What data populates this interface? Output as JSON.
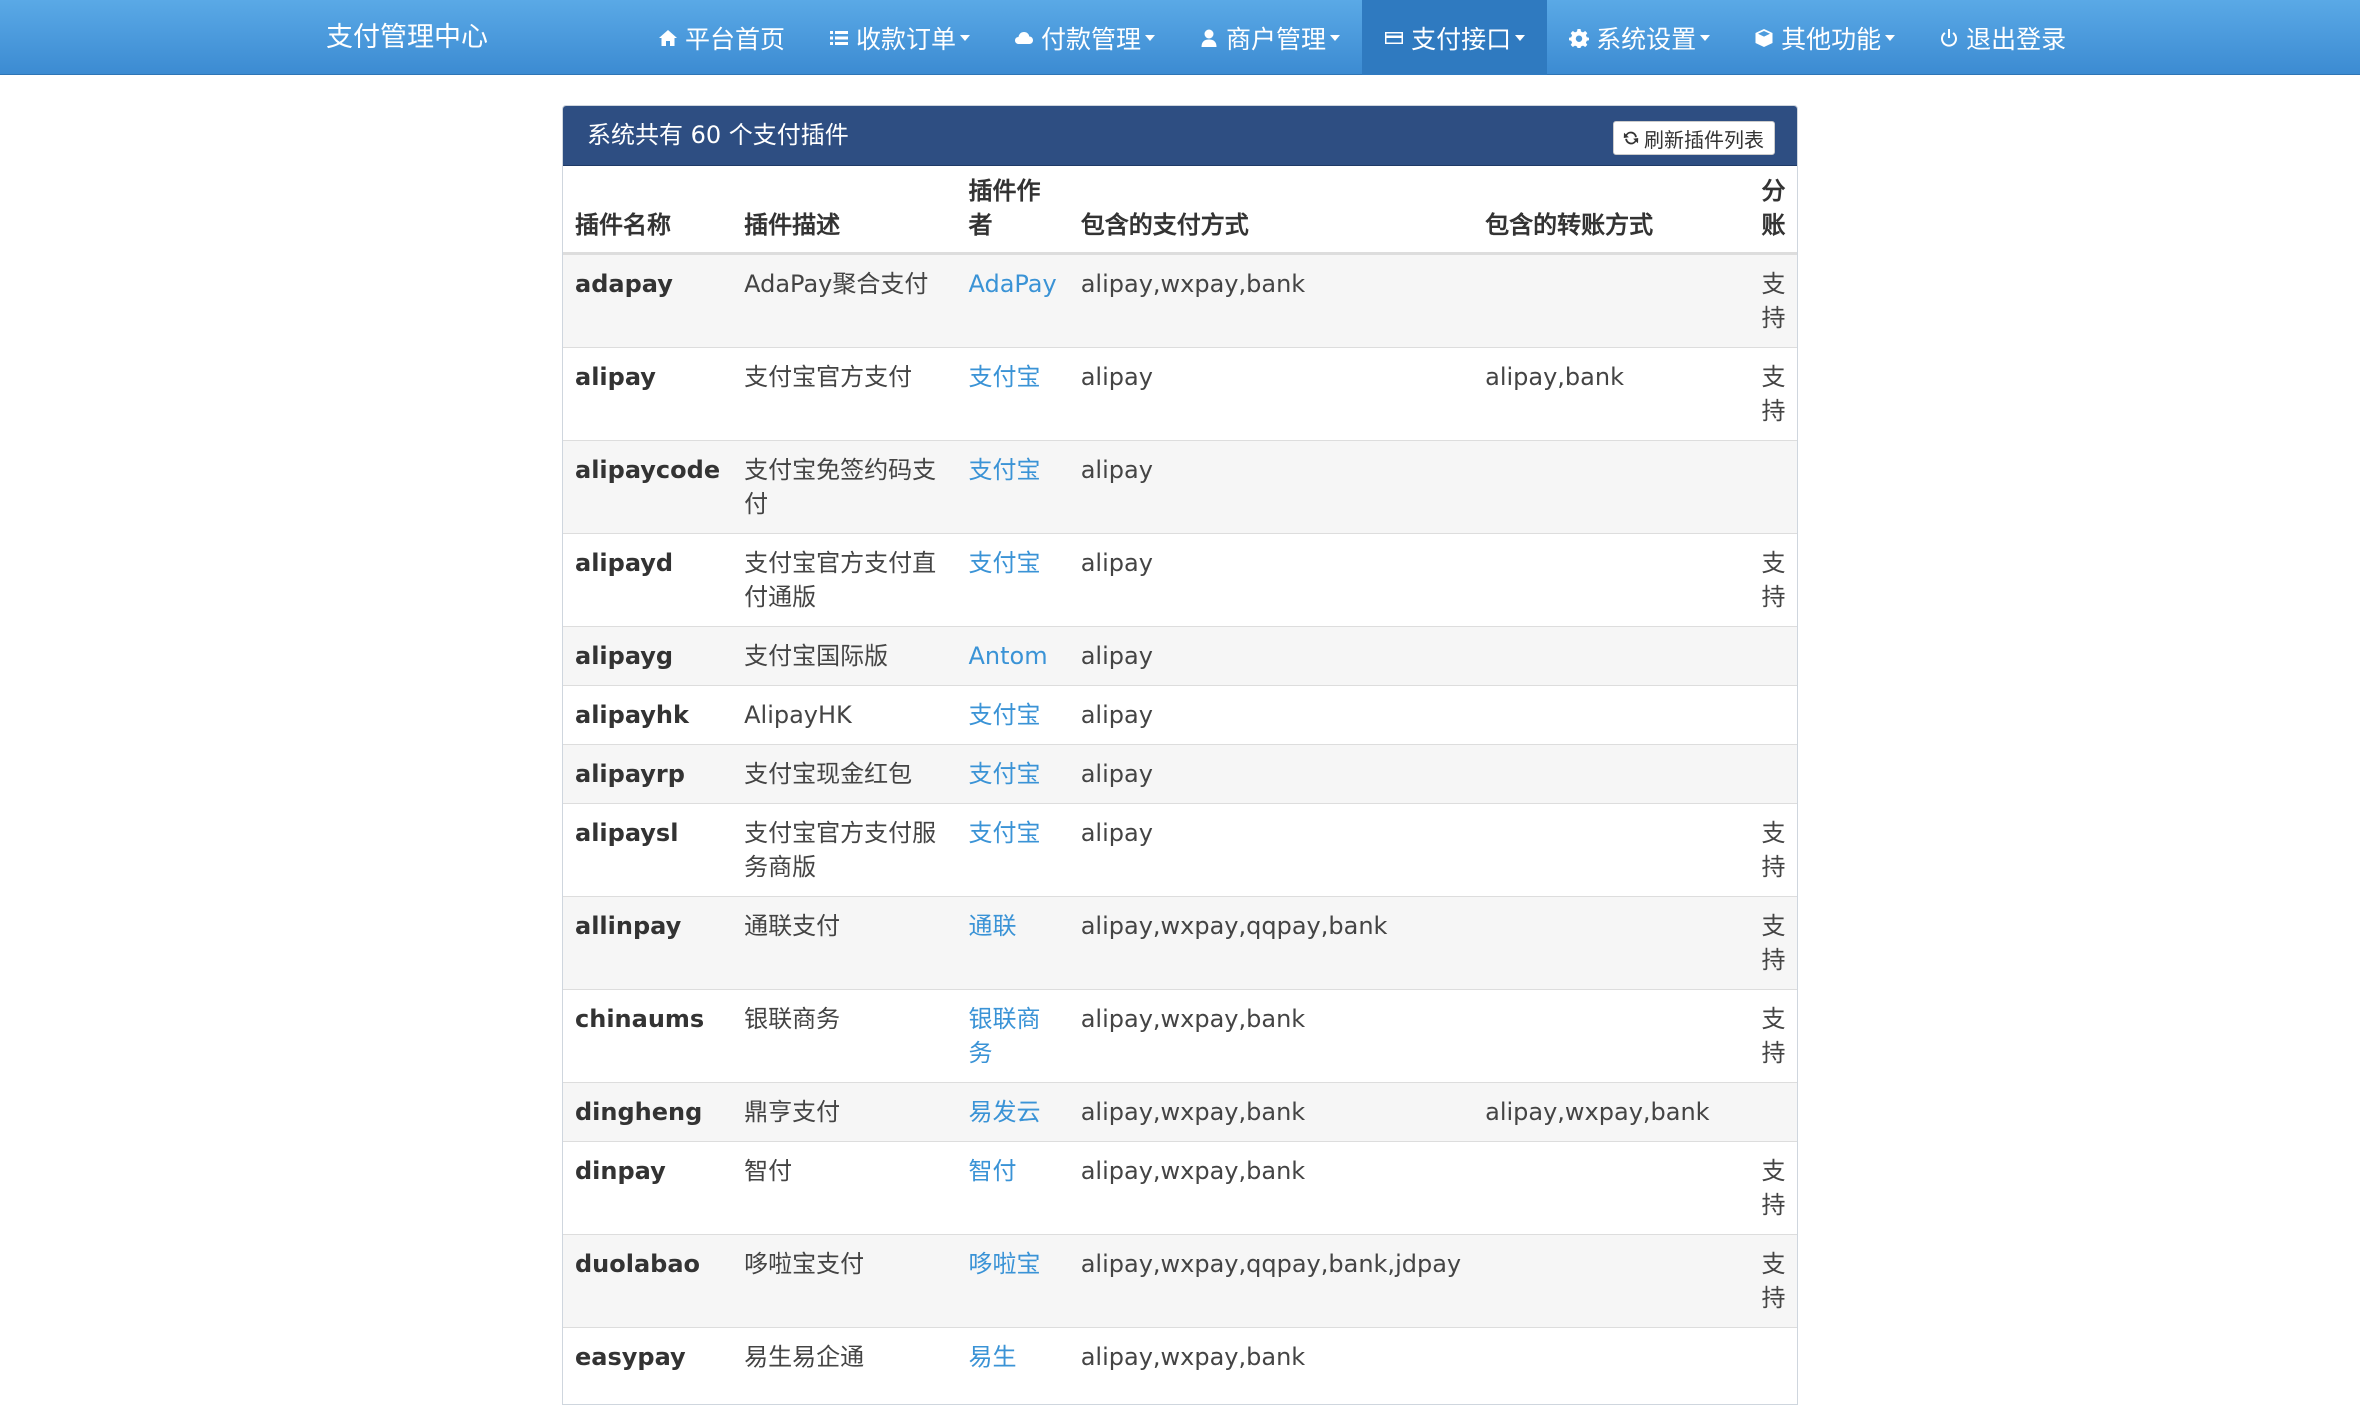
{
  "nav": {
    "brand": "支付管理中心",
    "items": [
      {
        "label": "平台首页",
        "icon": "home-icon",
        "dropdown": false,
        "active": false
      },
      {
        "label": "收款订单",
        "icon": "list-icon",
        "dropdown": true,
        "active": false
      },
      {
        "label": "付款管理",
        "icon": "cloud-icon",
        "dropdown": true,
        "active": false
      },
      {
        "label": "商户管理",
        "icon": "user-icon",
        "dropdown": true,
        "active": false
      },
      {
        "label": "支付接口",
        "icon": "credit-card-icon",
        "dropdown": true,
        "active": true
      },
      {
        "label": "系统设置",
        "icon": "gear-icon",
        "dropdown": true,
        "active": false
      },
      {
        "label": "其他功能",
        "icon": "cube-icon",
        "dropdown": true,
        "active": false
      },
      {
        "label": "退出登录",
        "icon": "power-icon",
        "dropdown": false,
        "active": false
      }
    ]
  },
  "panel": {
    "title": "系统共有 60 个支付插件",
    "refresh_label": "刷新插件列表"
  },
  "table": {
    "headers": [
      "插件名称",
      "插件描述",
      "插件作者",
      "包含的支付方式",
      "包含的转账方式",
      "分账"
    ],
    "rows": [
      {
        "name": "adapay",
        "desc": "AdaPay聚合支付",
        "author": "AdaPay",
        "pay": "alipay,wxpay,bank",
        "transfer": "",
        "split": "支持"
      },
      {
        "name": "alipay",
        "desc": "支付宝官方支付",
        "author": "支付宝",
        "pay": "alipay",
        "transfer": "alipay,bank",
        "split": "支持"
      },
      {
        "name": "alipaycode",
        "desc": "支付宝免签约码支付",
        "author": "支付宝",
        "pay": "alipay",
        "transfer": "",
        "split": ""
      },
      {
        "name": "alipayd",
        "desc": "支付宝官方支付直付通版",
        "author": "支付宝",
        "pay": "alipay",
        "transfer": "",
        "split": "支持"
      },
      {
        "name": "alipayg",
        "desc": "支付宝国际版",
        "author": "Antom",
        "pay": "alipay",
        "transfer": "",
        "split": ""
      },
      {
        "name": "alipayhk",
        "desc": "AlipayHK",
        "author": "支付宝",
        "pay": "alipay",
        "transfer": "",
        "split": ""
      },
      {
        "name": "alipayrp",
        "desc": "支付宝现金红包",
        "author": "支付宝",
        "pay": "alipay",
        "transfer": "",
        "split": ""
      },
      {
        "name": "alipaysl",
        "desc": "支付宝官方支付服务商版",
        "author": "支付宝",
        "pay": "alipay",
        "transfer": "",
        "split": "支持"
      },
      {
        "name": "allinpay",
        "desc": "通联支付",
        "author": "通联",
        "pay": "alipay,wxpay,qqpay,bank",
        "transfer": "",
        "split": "支持"
      },
      {
        "name": "chinaums",
        "desc": "银联商务",
        "author": "银联商务",
        "pay": "alipay,wxpay,bank",
        "transfer": "",
        "split": "支持"
      },
      {
        "name": "dingheng",
        "desc": "鼎亨支付",
        "author": "易发云",
        "pay": "alipay,wxpay,bank",
        "transfer": "alipay,wxpay,bank",
        "split": ""
      },
      {
        "name": "dinpay",
        "desc": "智付",
        "author": "智付",
        "pay": "alipay,wxpay,bank",
        "transfer": "",
        "split": "支持"
      },
      {
        "name": "duolabao",
        "desc": "哆啦宝支付",
        "author": "哆啦宝",
        "pay": "alipay,wxpay,qqpay,bank,jdpay",
        "transfer": "",
        "split": "支持"
      },
      {
        "name": "easypay",
        "desc": "易生易企通",
        "author": "易生",
        "pay": "alipay,wxpay,bank",
        "transfer": "",
        "split": ""
      }
    ]
  },
  "colors": {
    "nav_top": "#5aa9e6",
    "nav_bottom": "#3c8bd2",
    "nav_active": "#2f7ac0",
    "panel_heading": "#2e4e82",
    "author_link": "#3a93d6",
    "stripe": "#f6f6f6"
  }
}
